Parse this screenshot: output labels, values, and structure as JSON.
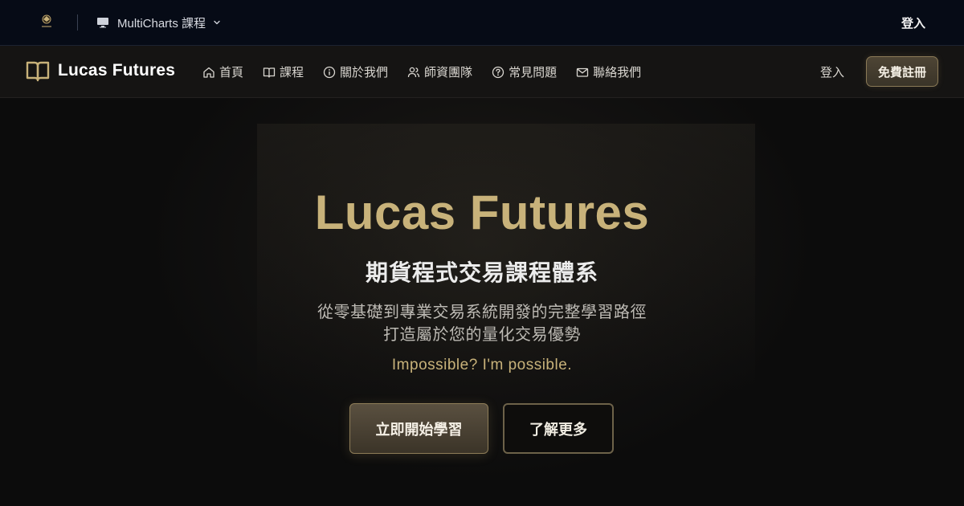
{
  "topbar": {
    "switcher_label": "MultiCharts 課程",
    "login_label": "登入"
  },
  "nav": {
    "brand": "Lucas Futures",
    "items": [
      {
        "label": "首頁",
        "icon": "home-icon"
      },
      {
        "label": "課程",
        "icon": "book-icon"
      },
      {
        "label": "關於我們",
        "icon": "info-icon"
      },
      {
        "label": "師資團隊",
        "icon": "users-icon"
      },
      {
        "label": "常見問題",
        "icon": "help-icon"
      },
      {
        "label": "聯絡我們",
        "icon": "mail-icon"
      }
    ],
    "login_label": "登入",
    "register_label": "免費註冊"
  },
  "hero": {
    "title": "Lucas Futures",
    "subtitle": "期貨程式交易課程體系",
    "description_line1": "從零基礎到專業交易系統開發的完整學習路徑",
    "description_line2": "打造屬於您的量化交易優勢",
    "tagline": "Impossible? I'm possible.",
    "primary_button": "立即開始學習",
    "secondary_button": "了解更多"
  },
  "colors": {
    "accent_gold": "#c8b27a",
    "topbar_bg": "#060b16",
    "navbar_bg": "#151413",
    "hero_bg": "#0c0c0c"
  }
}
